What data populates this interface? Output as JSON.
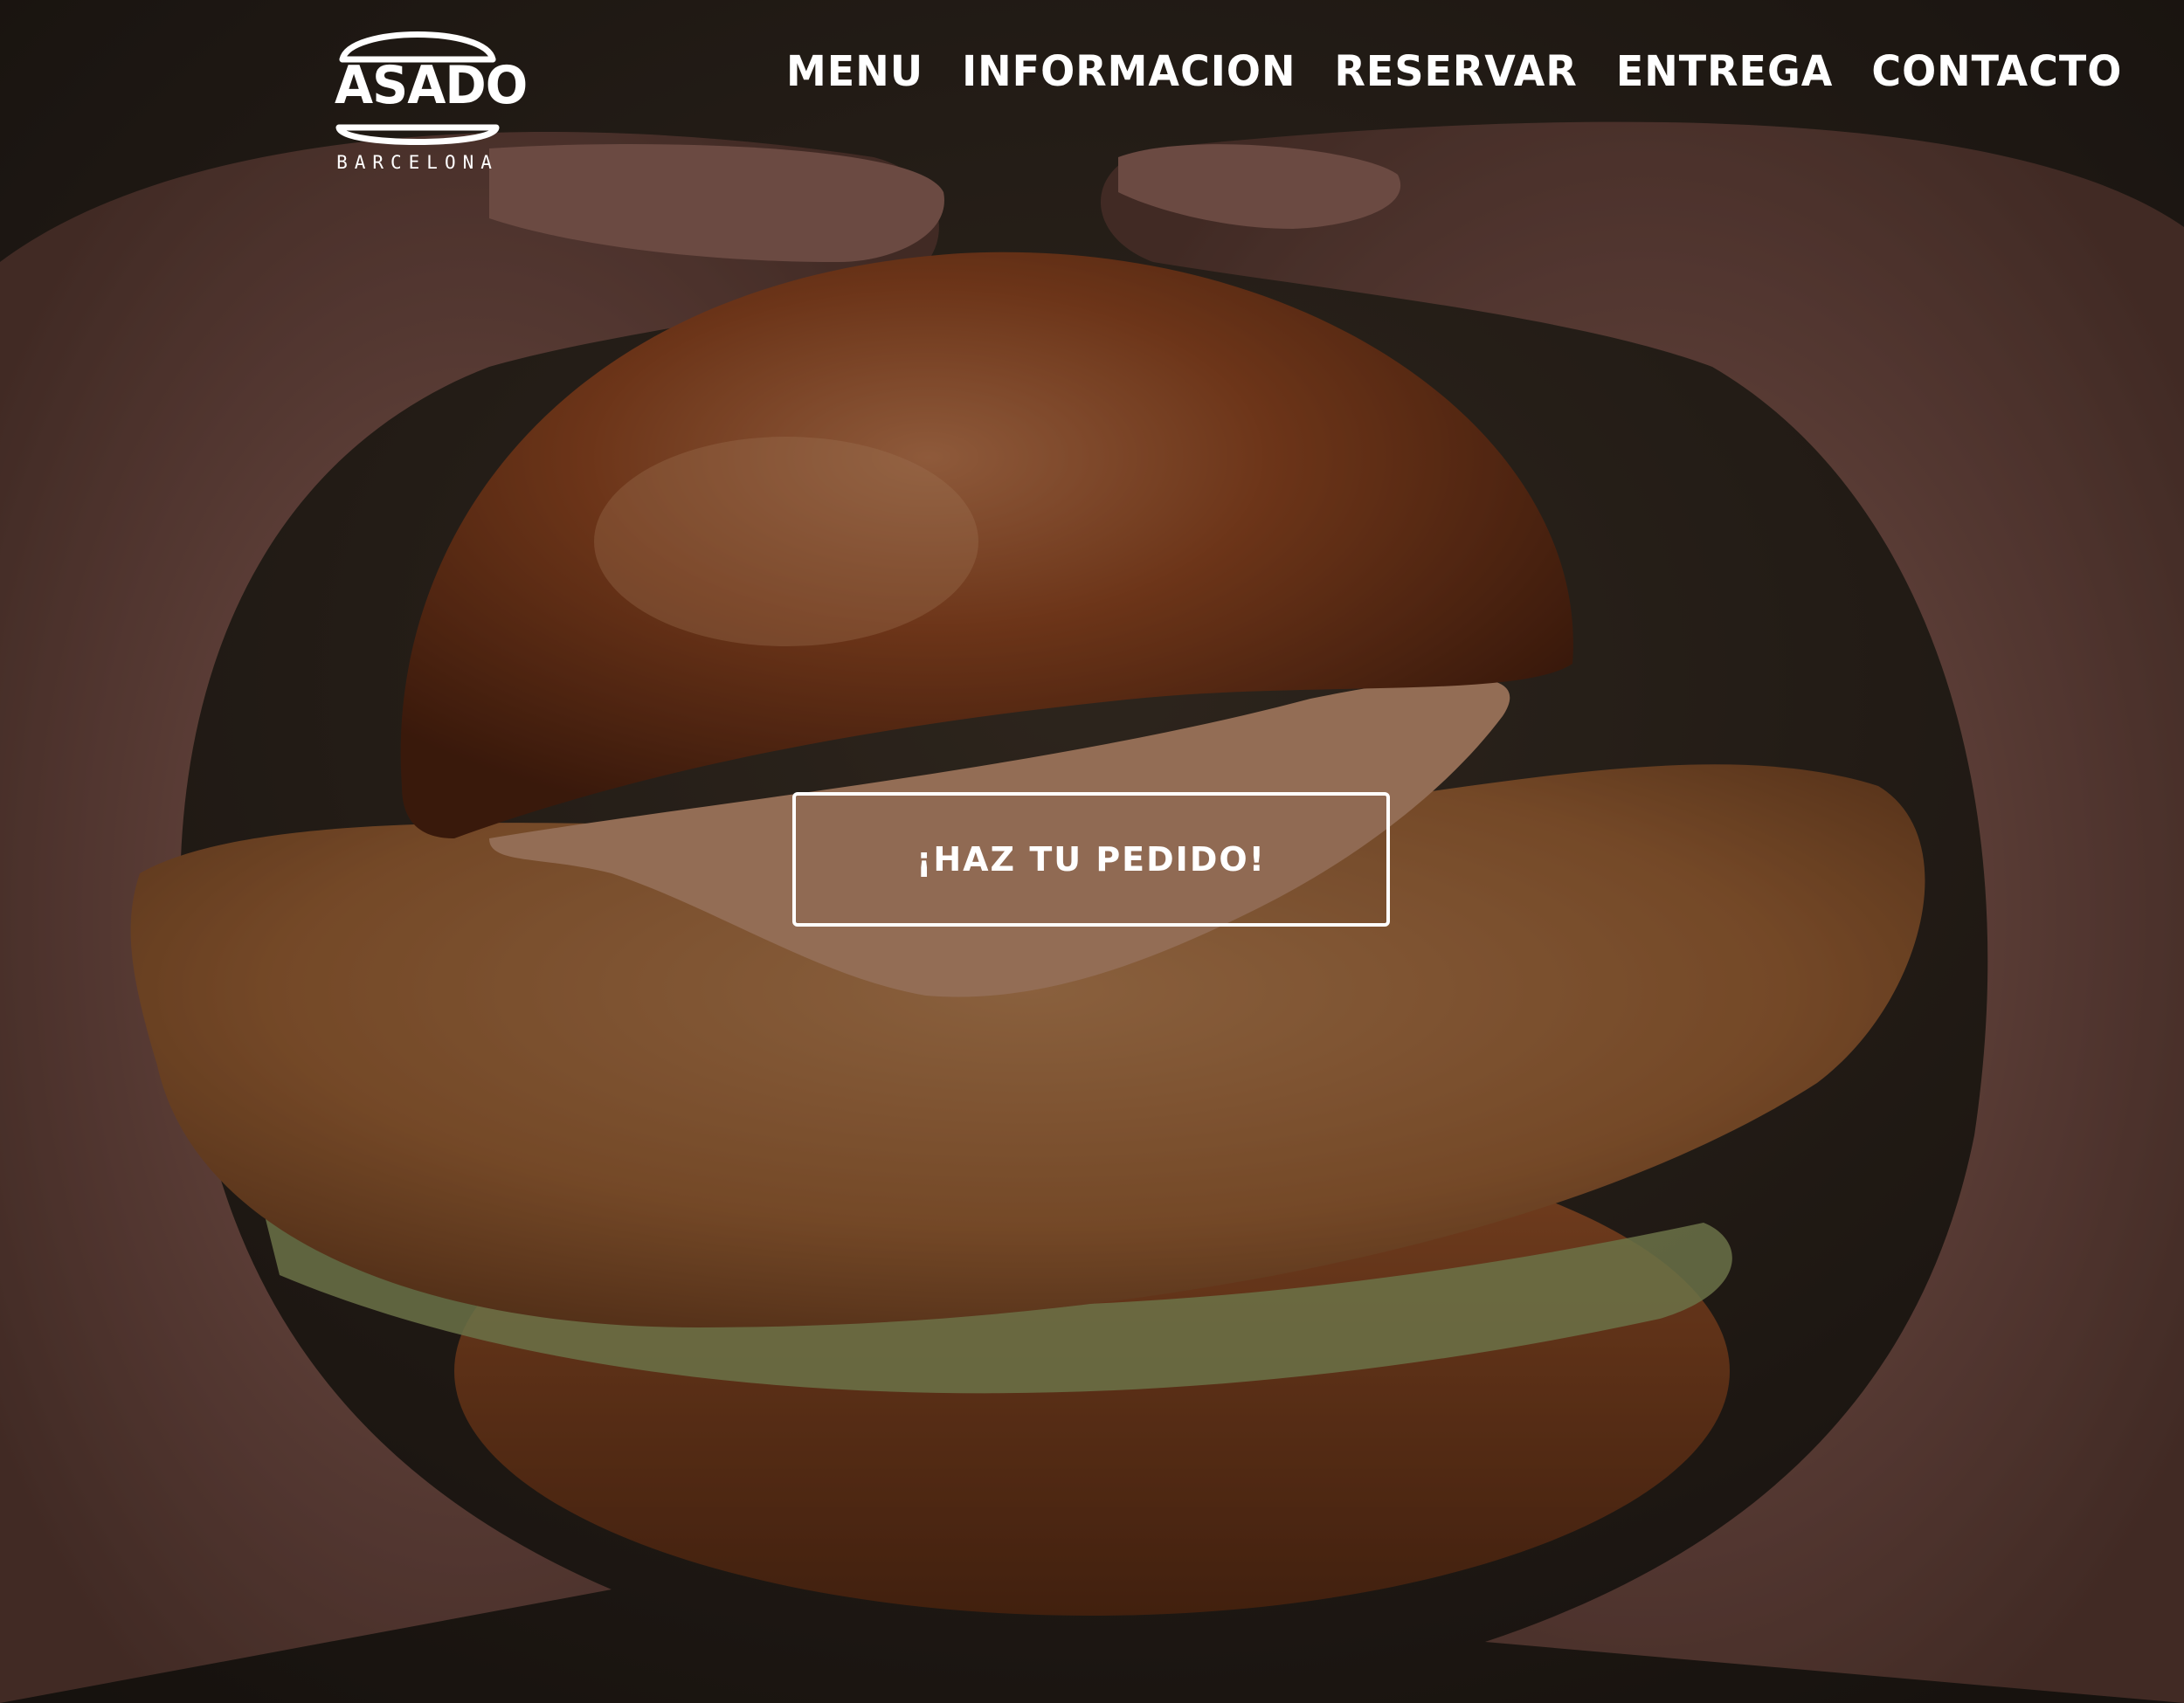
{
  "brand": {
    "name": "ASADO",
    "city": "BARCELONA"
  },
  "nav": {
    "items": [
      {
        "label": "MENU"
      },
      {
        "label": "iNFORMACION"
      },
      {
        "label": "RESERVAR"
      },
      {
        "label": "ENTREGA"
      },
      {
        "label": "CONTACTO"
      }
    ]
  },
  "hero": {
    "cta_label": "¡HAZ TU PEDIDO!"
  },
  "colors": {
    "text": "#ffffff",
    "bun": "#9a4a22",
    "chicken": "#b87a4a",
    "sauce": "#d9a07c",
    "skin": "#b37a6e"
  }
}
